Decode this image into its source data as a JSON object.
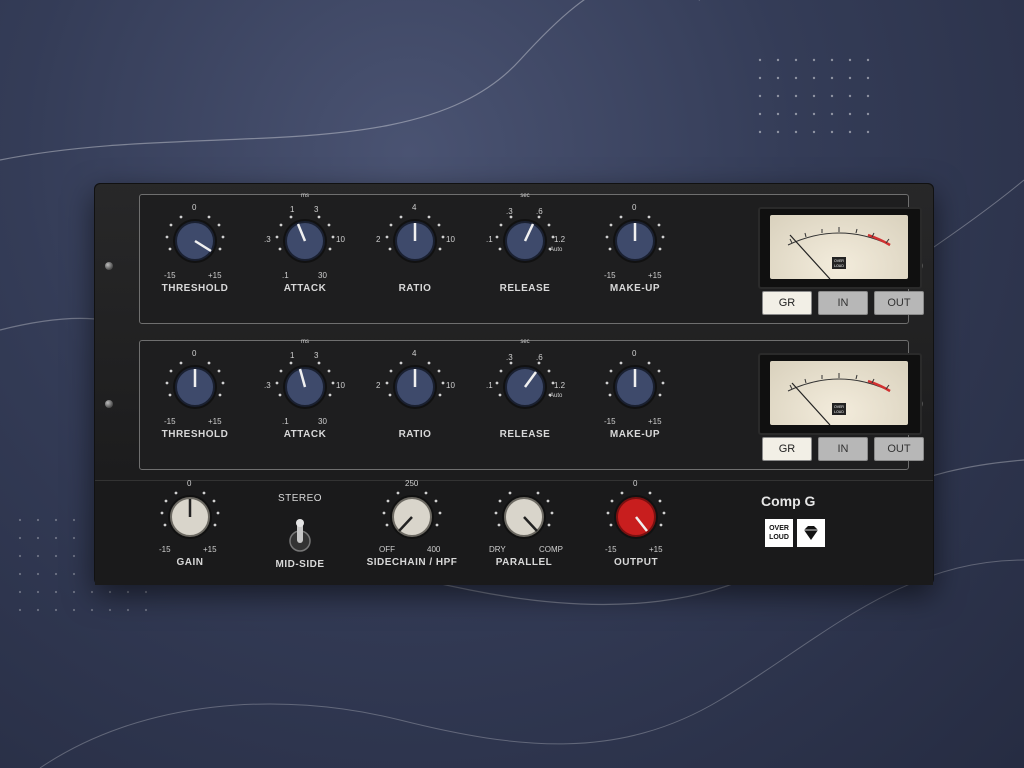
{
  "plugin": {
    "name": "Comp G"
  },
  "brand": {
    "line1": "OVER",
    "line2": "LOUD"
  },
  "channels": [
    {
      "threshold": {
        "label": "THRESHOLD",
        "top": "0",
        "min": "-15",
        "max": "+15"
      },
      "attack": {
        "label": "ATTACK",
        "unit": "ms",
        "marks": [
          ".1",
          "1",
          "3",
          "10",
          "30",
          ".3"
        ]
      },
      "ratio": {
        "label": "RATIO",
        "marks": [
          "2",
          "4",
          "10"
        ]
      },
      "release": {
        "label": "RELEASE",
        "unit": "sec",
        "marks": [
          ".1",
          ".3",
          ".6",
          "1.2",
          "Auto"
        ]
      },
      "makeup": {
        "label": "MAKE-UP",
        "top": "0",
        "min": "-15",
        "max": "+15"
      },
      "meter_buttons": [
        {
          "label": "GR",
          "active": true
        },
        {
          "label": "IN",
          "active": false
        },
        {
          "label": "OUT",
          "active": false
        }
      ],
      "meter_brand": "OVER LOUD"
    },
    {
      "threshold": {
        "label": "THRESHOLD",
        "top": "0",
        "min": "-15",
        "max": "+15"
      },
      "attack": {
        "label": "ATTACK",
        "unit": "ms",
        "marks": [
          ".1",
          "1",
          "3",
          "10",
          "30",
          ".3"
        ]
      },
      "ratio": {
        "label": "RATIO",
        "marks": [
          "2",
          "4",
          "10"
        ]
      },
      "release": {
        "label": "RELEASE",
        "unit": "sec",
        "marks": [
          ".1",
          ".3",
          ".6",
          "1.2",
          "Auto"
        ]
      },
      "makeup": {
        "label": "MAKE-UP",
        "top": "0",
        "min": "-15",
        "max": "+15"
      },
      "meter_buttons": [
        {
          "label": "GR",
          "active": true
        },
        {
          "label": "IN",
          "active": false
        },
        {
          "label": "OUT",
          "active": false
        }
      ],
      "meter_brand": "OVER LOUD"
    }
  ],
  "master": {
    "gain": {
      "label": "GAIN",
      "top": "0",
      "min": "-15",
      "max": "+15"
    },
    "stereo": {
      "top": "STEREO",
      "bottom": "MID-SIDE"
    },
    "sidechain": {
      "label": "SIDECHAIN / HPF",
      "top": "250",
      "min": "OFF",
      "max": "400"
    },
    "parallel": {
      "label": "PARALLEL",
      "min": "DRY",
      "max": "COMP"
    },
    "output": {
      "label": "OUTPUT",
      "top": "0",
      "min": "-15",
      "max": "+15"
    }
  },
  "colors": {
    "knob_blue": "#3e4a6b",
    "knob_cream": "#d9d5cb",
    "knob_red": "#c81e1e",
    "accent_meter_red": "#d23030"
  }
}
